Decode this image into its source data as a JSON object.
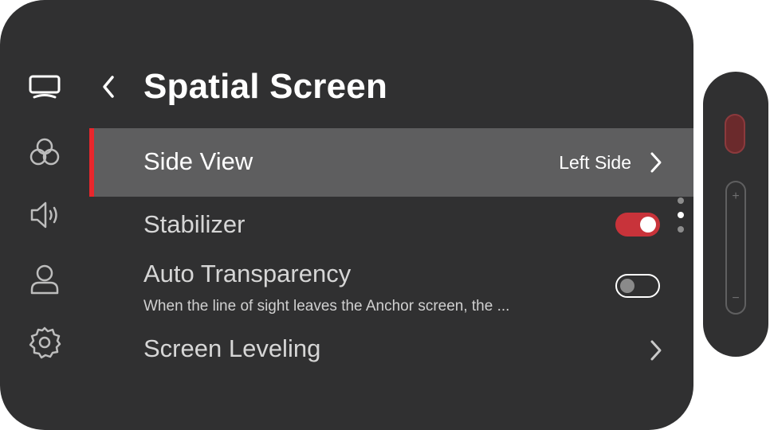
{
  "header": {
    "title": "Spatial Screen"
  },
  "nav": {
    "items": [
      {
        "icon": "display-icon",
        "active": true
      },
      {
        "icon": "color-circles-icon",
        "active": false
      },
      {
        "icon": "speaker-icon",
        "active": false
      },
      {
        "icon": "user-icon",
        "active": false
      },
      {
        "icon": "settings-gear-icon",
        "active": false
      }
    ]
  },
  "settings": {
    "side_view": {
      "label": "Side View",
      "value": "Left Side"
    },
    "stabilizer": {
      "label": "Stabilizer",
      "enabled": true
    },
    "auto_transparency": {
      "label": "Auto Transparency",
      "description": "When the line of sight leaves the Anchor screen, the ...",
      "enabled": false
    },
    "screen_leveling": {
      "label": "Screen Leveling"
    }
  },
  "pager": {
    "count": 3,
    "active_index": 1
  },
  "side_controls": {
    "volume_plus": "+",
    "volume_minus": "−"
  },
  "colors": {
    "panel_bg": "#303031",
    "selected_row_bg": "#5e5e5f",
    "accent_red": "#e8262c",
    "toggle_on": "#c8333a"
  }
}
